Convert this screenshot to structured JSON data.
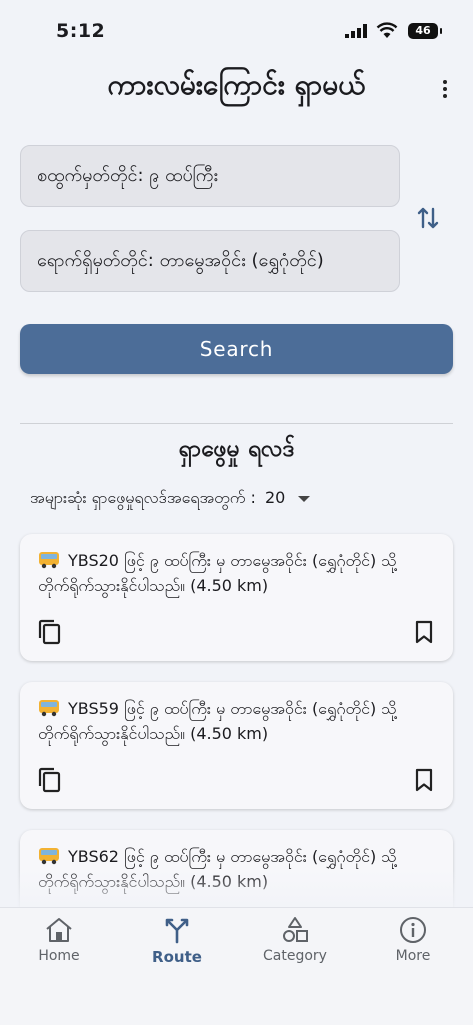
{
  "status": {
    "time": "5:12",
    "battery": "46"
  },
  "header": {
    "title": "ကားလမ်းကြောင်း ရှာမယ်"
  },
  "form": {
    "from_value": "စထွက်မှတ်တိုင်: ၉ ထပ်ကြီး",
    "to_value": "ရောက်ရှိမှတ်တိုင်: တာမွေအဝိုင်း (ရွှေဂုံတိုင်)",
    "search_label": "Search"
  },
  "results": {
    "title": "ရှာဖွေမှု ရလဒ်",
    "max_label": "အများဆုံး ရှာဖွေမှုရလဒ်အရေအတွက် :",
    "max_value": "20",
    "items": [
      {
        "text": "YBS20 ဖြင့် ၉ ထပ်ကြီး မှ တာမွေအဝိုင်း (ရွှေဂုံတိုင်) သို့ တိုက်ရိုက်သွားနိုင်ပါသည်။ (4.50 km)"
      },
      {
        "text": "YBS59 ဖြင့် ၉ ထပ်ကြီး မှ တာမွေအဝိုင်း (ရွှေဂုံတိုင်) သို့ တိုက်ရိုက်သွားနိုင်ပါသည်။ (4.50 km)"
      },
      {
        "text": "YBS62 ဖြင့် ၉ ထပ်ကြီး မှ တာမွေအဝိုင်း (ရွှေဂုံတိုင်) သို့ တိုက်ရိုက်သွားနိုင်ပါသည်။ (4.50 km)"
      }
    ]
  },
  "nav": [
    {
      "label": "Home",
      "icon": "home-icon"
    },
    {
      "label": "Route",
      "icon": "route-icon",
      "active": true
    },
    {
      "label": "Category",
      "icon": "category-icon"
    },
    {
      "label": "More",
      "icon": "info-icon"
    }
  ],
  "colors": {
    "primary": "#4c6d98",
    "active_nav": "#3f5f88",
    "background": "#f1f3f8"
  }
}
